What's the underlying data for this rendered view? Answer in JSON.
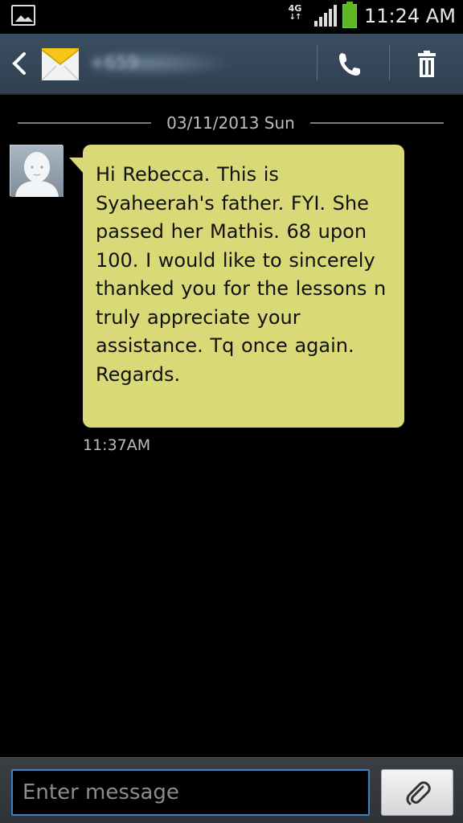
{
  "status_bar": {
    "network": "4G",
    "network_arrows": "↓↑",
    "time": "11:24 AM",
    "icons": [
      "gallery-icon",
      "signal-icon",
      "battery-icon"
    ]
  },
  "action_bar": {
    "contact": "+659",
    "icons": [
      "back-icon",
      "envelope-icon",
      "phone-icon",
      "trash-icon"
    ]
  },
  "conversation": {
    "date": "03/11/2013 Sun",
    "messages": [
      {
        "text": "Hi Rebecca. This is Syaheerah's father. FYI. She passed her Mathis. 68 upon 100. I would like to sincerely thanked you for the lessons n truly appreciate your assistance. Tq once again. Regards.",
        "time": "11:37AM",
        "bubble_color": "#d9d978"
      }
    ]
  },
  "composer": {
    "placeholder": "Enter message",
    "value": "",
    "attach_icon": "paperclip-icon"
  },
  "colors": {
    "action_bar": "#34475a",
    "input_border": "#3b80bf",
    "battery": "#5fb820"
  }
}
